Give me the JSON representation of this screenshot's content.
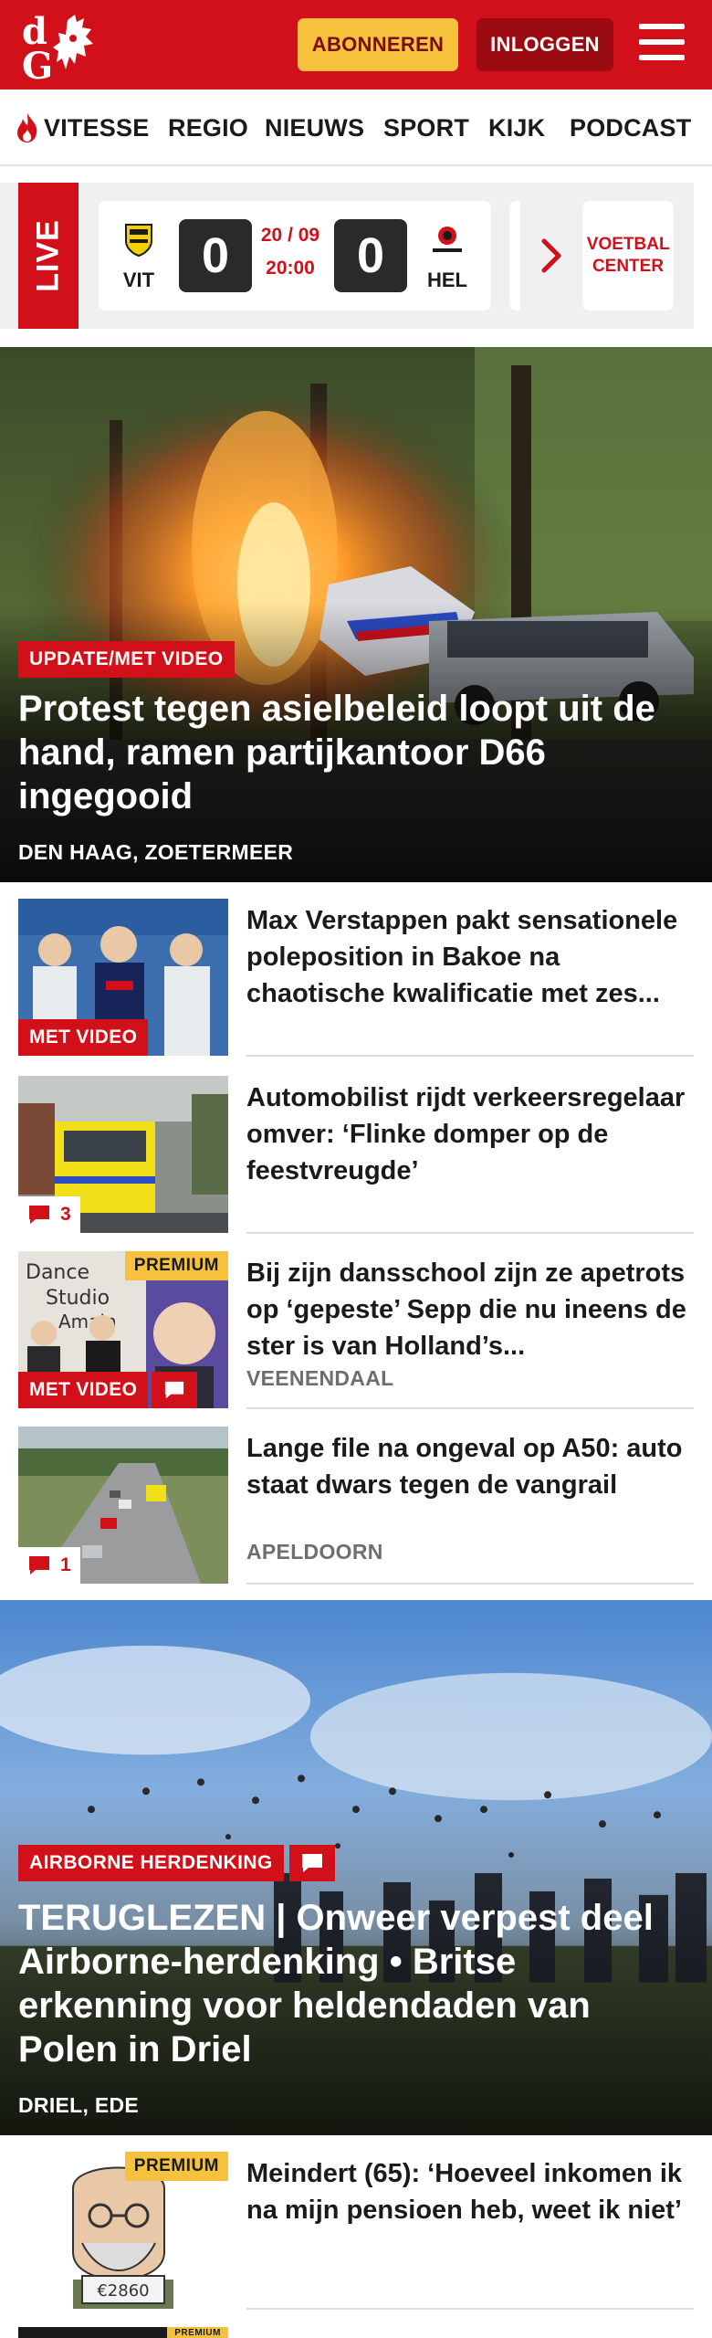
{
  "header": {
    "subscribe_label": "ABONNEREN",
    "login_label": "INLOGGEN",
    "brand_color": "#d2101a"
  },
  "nav": {
    "items": [
      {
        "label": "VITESSE",
        "icon": "flame-icon"
      },
      {
        "label": "REGIO"
      },
      {
        "label": "NIEUWS"
      },
      {
        "label": "SPORT"
      },
      {
        "label": "KIJK"
      },
      {
        "label": "PODCAST"
      }
    ]
  },
  "live": {
    "tag": "LIVE",
    "home_team": "VIT",
    "away_team": "HEL",
    "home_score": "0",
    "away_score": "0",
    "date": "20 / 09",
    "time": "20:00",
    "voetbal_center": "VOETBAL CENTER"
  },
  "hero": {
    "label": "UPDATE/MET VIDEO",
    "title": "Protest tegen asielbeleid loopt uit de hand, ramen partijkantoor D66 ingegooid",
    "location": "DEN HAAG, ZOETERMEER"
  },
  "articles": [
    {
      "title": "Max Verstappen pakt sensationele poleposition in Bakoe na chaotische kwalificatie met zes...",
      "badge": "MET VIDEO"
    },
    {
      "title": "Automobilist rijdt verkeersregelaar omver: ‘Flinke domper op de feestvreugde’",
      "comments": "3"
    },
    {
      "title": "Bij zijn dansschool zijn ze apetrots op ‘gepeste’ Sepp die nu ineens de ster is van Holland’s...",
      "badge": "MET VIDEO",
      "premium": "PREMIUM",
      "location": "VEENENDAAL"
    },
    {
      "title": "Lange file na ongeval op A50: auto staat dwars tegen de vangrail",
      "comments": "1",
      "location": "APELDOORN"
    }
  ],
  "hero2": {
    "label": "AIRBORNE HERDENKING",
    "title": "TERUGLEZEN | Onweer verpest deel Airborne-herdenking • Britse erkenning voor heldendaden van Polen in Driel",
    "location": "DRIEL, EDE"
  },
  "article5": {
    "title": "Meindert (65): ‘Hoeveel inkomen ik na mijn pensioen heb, weet ik niet’",
    "premium": "PREMIUM",
    "sign_text": "€2860"
  },
  "article6": {
    "premium": "PREMIUM"
  }
}
